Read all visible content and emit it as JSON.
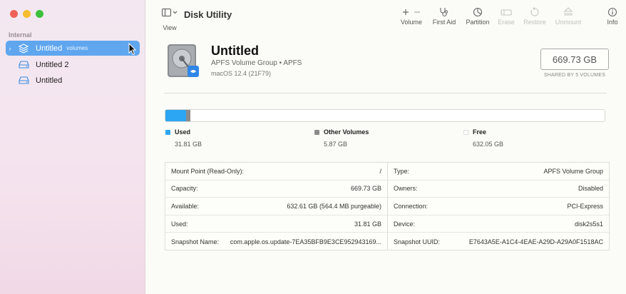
{
  "sidebar": {
    "section_label": "Internal",
    "items": [
      {
        "label": "Untitled",
        "sub": "volumes",
        "icon": "layers-icon",
        "selected": true
      },
      {
        "label": "Untitled 2",
        "icon": "drive-icon"
      },
      {
        "label": "Untitled",
        "icon": "drive-icon"
      }
    ]
  },
  "toolbar": {
    "view_label": "View",
    "title": "Disk Utility",
    "volume_label": "Volume",
    "firstaid_label": "First Aid",
    "partition_label": "Partition",
    "erase_label": "Erase",
    "restore_label": "Restore",
    "unmount_label": "Unmount",
    "info_label": "Info"
  },
  "volume": {
    "name": "Untitled",
    "subtitle": "APFS Volume Group • APFS",
    "os": "macOS 12.4 (21F79)",
    "capacity": "669.73 GB",
    "shared": "SHARED BY 5 VOLUMES"
  },
  "usage": {
    "used_fraction": 0.0475,
    "other_fraction": 0.0088,
    "legend": [
      {
        "label": "Used",
        "value": "31.81 GB",
        "color": "#2ca5f2"
      },
      {
        "label": "Other Volumes",
        "value": "5.87 GB",
        "color": "#8b8b8b"
      },
      {
        "label": "Free",
        "value": "632.05 GB",
        "color": "#ffffff"
      }
    ]
  },
  "info_left": [
    {
      "key": "Mount Point (Read-Only):",
      "value": "/"
    },
    {
      "key": "Capacity:",
      "value": "669.73 GB"
    },
    {
      "key": "Available:",
      "value": "632.61 GB (564.4 MB purgeable)"
    },
    {
      "key": "Used:",
      "value": "31.81 GB"
    },
    {
      "key": "Snapshot Name:",
      "value": "com.apple.os.update-7EA35BFB9E3CE952943169..."
    }
  ],
  "info_right": [
    {
      "key": "Type:",
      "value": "APFS Volume Group"
    },
    {
      "key": "Owners:",
      "value": "Disabled"
    },
    {
      "key": "Connection:",
      "value": "PCI-Express"
    },
    {
      "key": "Device:",
      "value": "disk2s5s1"
    },
    {
      "key": "Snapshot UUID:",
      "value": "E7643A5E-A1C4-4EAE-A29D-A29A0F1518AC"
    }
  ]
}
